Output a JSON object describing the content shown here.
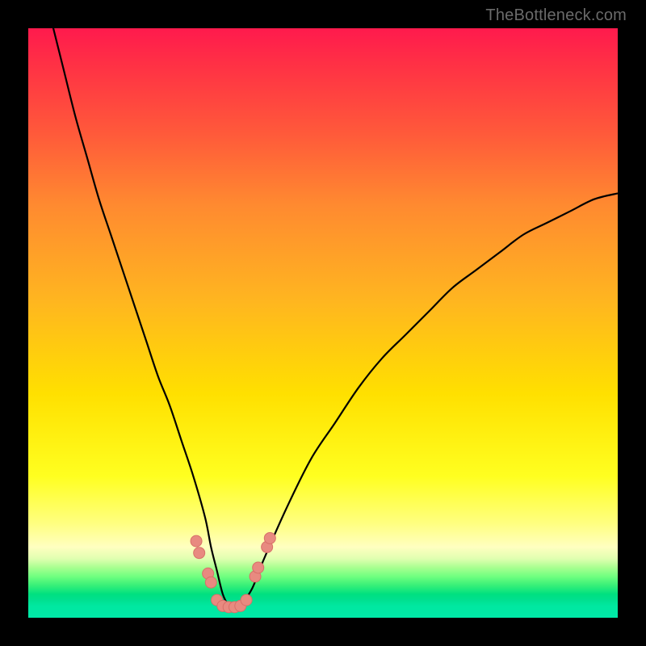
{
  "watermark": "TheBottleneck.com",
  "colors": {
    "frame": "#000000",
    "gradient_top": "#ff1a4d",
    "gradient_mid": "#ffe000",
    "gradient_bottom": "#00e090",
    "curve": "#000000",
    "markers": "#e88a80"
  },
  "chart_data": {
    "type": "line",
    "title": "",
    "xlabel": "",
    "ylabel": "",
    "xlim": [
      0,
      100
    ],
    "ylim": [
      0,
      100
    ],
    "grid": false,
    "legend": false,
    "series": [
      {
        "name": "bottleneck-curve",
        "x": [
          4,
          6,
          8,
          10,
          12,
          14,
          16,
          18,
          20,
          22,
          24,
          26,
          28,
          30,
          31,
          32,
          33,
          34,
          35,
          36,
          38,
          40,
          44,
          48,
          52,
          56,
          60,
          64,
          68,
          72,
          76,
          80,
          84,
          88,
          92,
          96,
          100
        ],
        "values": [
          101,
          93,
          85,
          78,
          71,
          65,
          59,
          53,
          47,
          41,
          36,
          30,
          24,
          17,
          12,
          8,
          4,
          2,
          1,
          2,
          5,
          10,
          19,
          27,
          33,
          39,
          44,
          48,
          52,
          56,
          59,
          62,
          65,
          67,
          69,
          71,
          72
        ]
      }
    ],
    "markers": [
      {
        "x": 28.5,
        "y": 13
      },
      {
        "x": 29.0,
        "y": 11
      },
      {
        "x": 30.5,
        "y": 7.5
      },
      {
        "x": 31.0,
        "y": 6
      },
      {
        "x": 32.0,
        "y": 3
      },
      {
        "x": 33.0,
        "y": 2
      },
      {
        "x": 34.0,
        "y": 1.8
      },
      {
        "x": 35.0,
        "y": 1.8
      },
      {
        "x": 36.0,
        "y": 2
      },
      {
        "x": 37.0,
        "y": 3
      },
      {
        "x": 38.5,
        "y": 7
      },
      {
        "x": 39.0,
        "y": 8.5
      },
      {
        "x": 40.5,
        "y": 12
      },
      {
        "x": 41.0,
        "y": 13.5
      }
    ],
    "annotations": []
  }
}
